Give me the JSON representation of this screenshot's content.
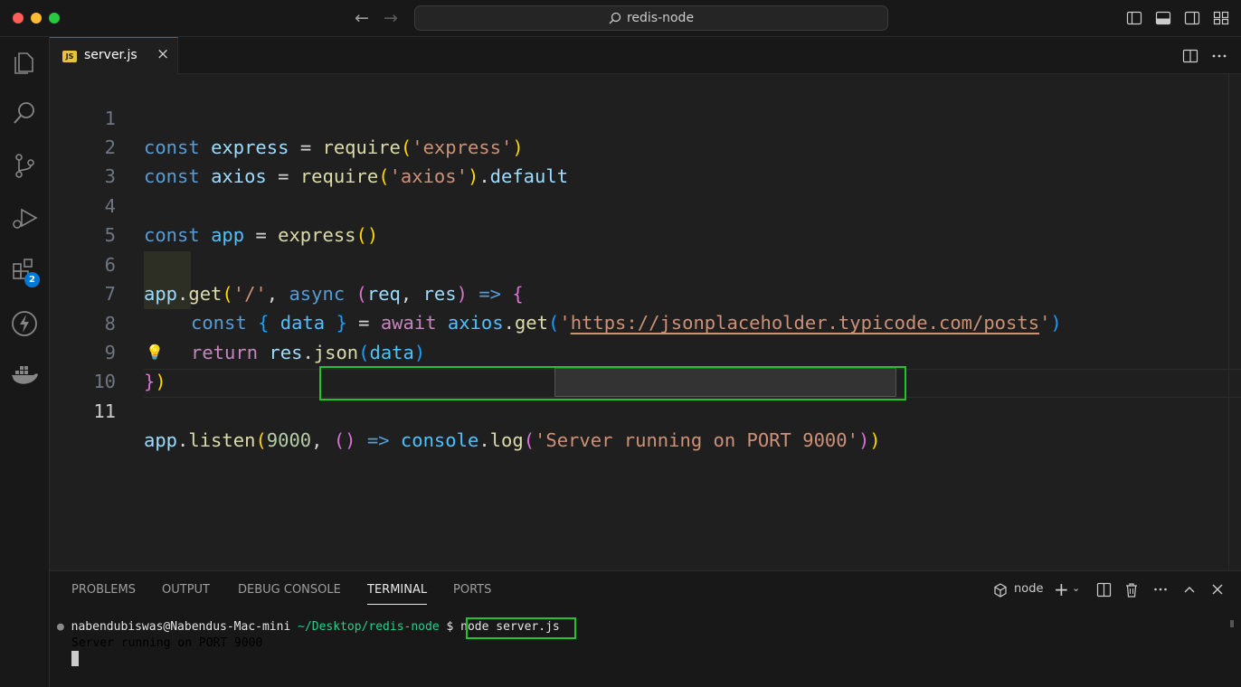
{
  "window": {
    "search_label": "redis-node"
  },
  "activity": {
    "extensions_badge": "2"
  },
  "tab": {
    "icon_text": "JS",
    "filename": "server.js",
    "close": "×"
  },
  "code": {
    "line_numbers": [
      "1",
      "2",
      "3",
      "4",
      "5",
      "6",
      "7",
      "8",
      "9",
      "10",
      "11"
    ],
    "l1": {
      "a": "const",
      "b": "express",
      "c": "=",
      "d": "require",
      "e": "(",
      "f": "'express'",
      "g": ")"
    },
    "l2": {
      "a": "const",
      "b": "axios",
      "c": "=",
      "d": "require",
      "e": "(",
      "f": "'axios'",
      "g": ")",
      "h": ".",
      "i": "default"
    },
    "l4": {
      "a": "const",
      "b": "app",
      "c": "=",
      "d": "express",
      "e": "()"
    },
    "l6": {
      "a": "app",
      "b": ".",
      "c": "get",
      "d": "(",
      "e": "'/'",
      "f": ",",
      "g": "async",
      "h": "(",
      "i": "req",
      "j": ",",
      "k": "res",
      "l": ")",
      "m": "=>",
      "n": "{"
    },
    "l7": {
      "a": "const",
      "b": "{",
      "c": "data",
      "d": "}",
      "e": "=",
      "f": "await",
      "g": "axios",
      "h": ".",
      "i": "get",
      "j": "(",
      "k": "'",
      "l": "https://jsonplaceholder.typicode.com/posts",
      "m": "'",
      "n": ")"
    },
    "l8": {
      "a": "return",
      "b": "res",
      "c": ".",
      "d": "json",
      "e": "(",
      "f": "data",
      "g": ")"
    },
    "l9": {
      "a": "}",
      "b": ")"
    },
    "l11": {
      "a": "app",
      "b": ".",
      "c": "listen",
      "d": "(",
      "e": "9000",
      "f": ",",
      "g": "()",
      "h": "=>",
      "i": "console",
      "j": ".",
      "k": "log",
      "l": "(",
      "m": "'Server running on PORT 9000'",
      "n": ")",
      "o": ")"
    }
  },
  "panel": {
    "tabs": [
      "PROBLEMS",
      "OUTPUT",
      "DEBUG CONSOLE",
      "TERMINAL",
      "PORTS"
    ],
    "terminal_name": "node",
    "prompt_user": "nabendubiswas@Nabendus-Mac-mini",
    "prompt_path": "~/Desktop/redis-node",
    "prompt_symbol": "$",
    "command": "node server.js",
    "output": "Server running on PORT 9000"
  },
  "colors": {
    "accent": "#0078d4",
    "highlight_box": "#22c32c"
  }
}
